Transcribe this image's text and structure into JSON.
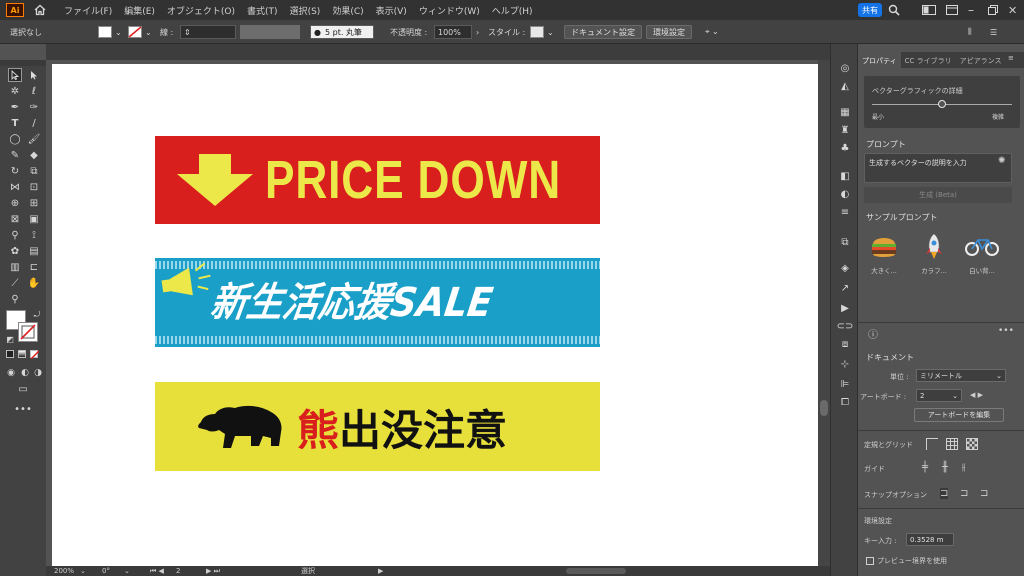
{
  "menubar": {
    "logo": "Ai",
    "items": [
      "ファイル(F)",
      "編集(E)",
      "オブジェクト(O)",
      "書式(T)",
      "選択(S)",
      "効果(C)",
      "表示(V)",
      "ウィンドウ(W)",
      "ヘルプ(H)"
    ],
    "share_label": "共有"
  },
  "controlbar": {
    "selection_status": "選択なし",
    "stroke_label": "線 :",
    "brush_label": "5 pt. 丸筆",
    "opacity_label": "不透明度 :",
    "opacity_value": "100%",
    "style_label": "スタイル :",
    "document_setup_button": "ドキュメント設定",
    "preferences_button": "環境設定"
  },
  "artwork": {
    "banner1": {
      "text": "PRICE DOWN",
      "bg_color": "#d91e1e",
      "text_color": "#ede84a"
    },
    "banner2": {
      "text": "新生活応援SALE",
      "bg_color": "#1aa0c8",
      "text_color": "#ffffff"
    },
    "banner3": {
      "text_accent": "熊",
      "text_rest": "出没注意",
      "bg_color": "#e8e03a",
      "accent_color": "#d91e1e",
      "text_color": "#111111"
    }
  },
  "statusbar": {
    "zoom": "200%",
    "rotation": "0°",
    "artboard": "2",
    "tool": "選択"
  },
  "properties": {
    "tabs": [
      "プロパティ",
      "CC ライブラリ",
      "アピアランス"
    ],
    "active_tab": 0,
    "vector_detail_label": "ベクターグラフィックの詳細",
    "slider_min": "最小",
    "slider_max": "複雑",
    "slider_level": 0.5,
    "prompt_section": "プロンプト",
    "prompt_placeholder": "生成するベクターの説明を入力",
    "generate_button": "生成 (Beta)",
    "sample_prompts_label": "サンプルプロンプト",
    "samples": [
      {
        "label": "大きく...",
        "icon": "hamburger-icon"
      },
      {
        "label": "カラフ...",
        "icon": "rocket-icon"
      },
      {
        "label": "白い背...",
        "icon": "bicycle-icon"
      }
    ],
    "document_label": "ドキュメント",
    "unit_label": "単位 :",
    "unit_value": "ミリメートル",
    "artboard_label": "アートボード :",
    "artboard_value": "2",
    "edit_artboard_button": "アートボードを編集",
    "rulers_grid_label": "定規とグリッド",
    "guides_label": "ガイド",
    "snap_label": "スナップオプション",
    "prefs_label": "環境設定",
    "key_input_label": "キー入力 :",
    "key_input_value": "0.3528 m",
    "preview_bounds_label": "プレビュー境界を使用"
  }
}
